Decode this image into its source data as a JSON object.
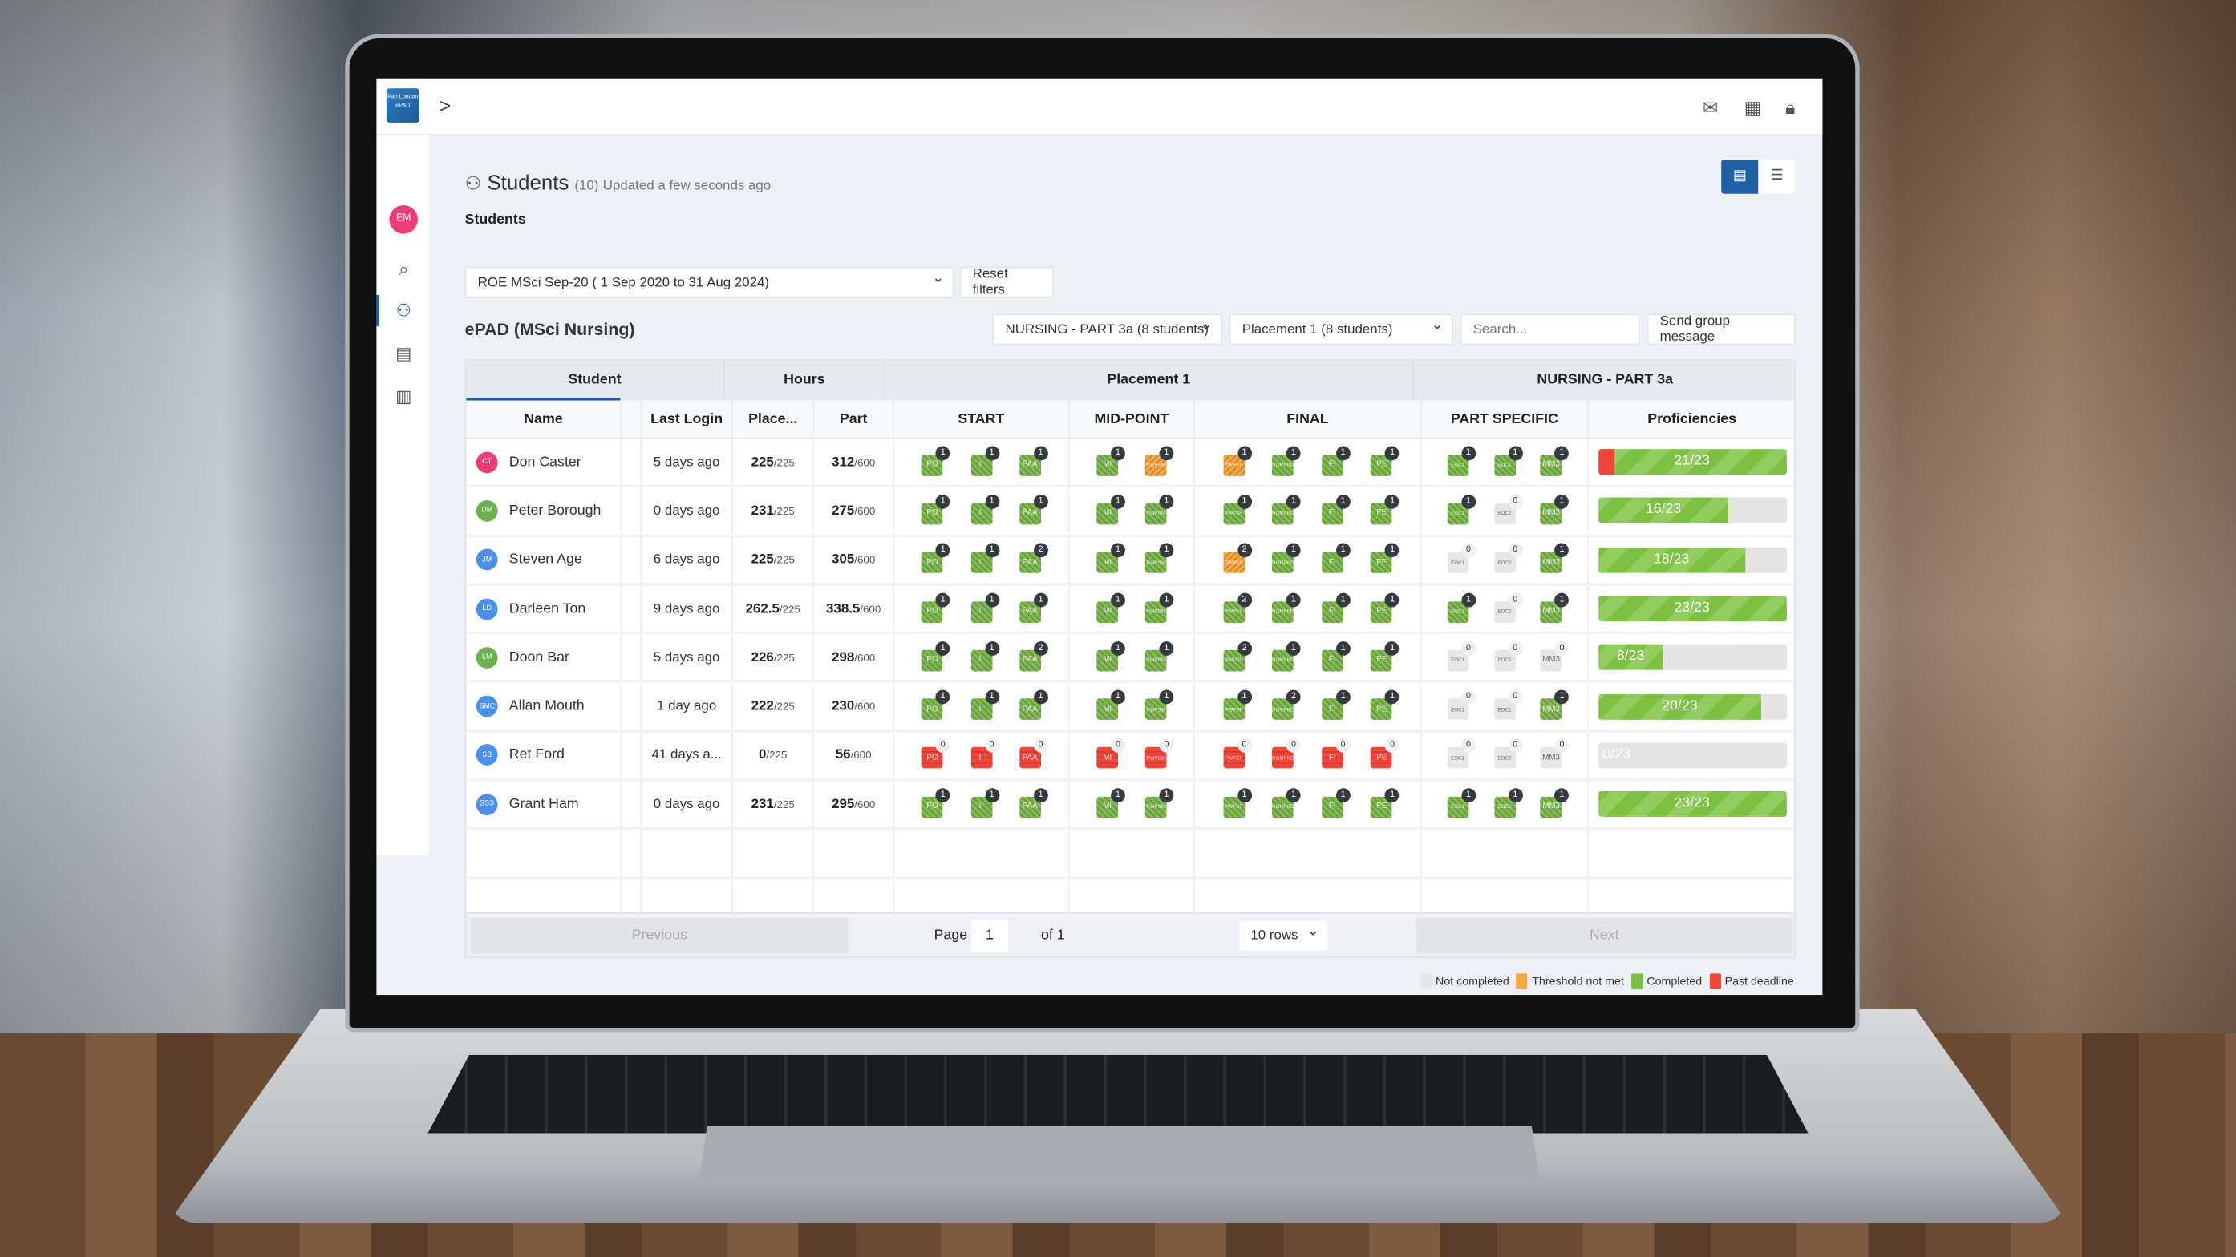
{
  "app": {
    "logo_text": "Pan London ePAD",
    "breadcrumb_icon": "chevron-right-icon",
    "user_initials": "EM",
    "top_icons": [
      "mail-icon",
      "grid-icon",
      "lock-icon"
    ],
    "side_icons": [
      "search-icon",
      "students-icon",
      "calendar-icon",
      "calculator-icon"
    ]
  },
  "page": {
    "title": "Students",
    "count": "(10)",
    "updated": "Updated a few seconds ago",
    "subtitle": "Students",
    "cohort_select": "ROE MSci Sep-20 ( 1 Sep 2020 to 31 Aug 2024)",
    "reset_label": "Reset filters",
    "section_title": "ePAD (MSci Nursing)",
    "part_select": "NURSING - PART 3a (8 students)",
    "placement_select": "Placement 1 (8 students)",
    "search_placeholder": "Search...",
    "send_label": "Send group message",
    "view_toggle": [
      "table-view-icon",
      "list-view-icon"
    ],
    "accent": "#1f5fa6"
  },
  "table": {
    "group_headers": [
      "Student",
      "Hours",
      "Placement 1",
      "NURSING - PART 3a"
    ],
    "headers": [
      "Name",
      "Last Login",
      "Place...",
      "Part",
      "START",
      "MID-POINT",
      "FINAL",
      "PART SPECIFIC",
      "Proficiencies"
    ],
    "tile_labels": {
      "start": [
        "PO",
        "II",
        "PAA"
      ],
      "mid": [
        "MI",
        "PWPSM"
      ],
      "final": [
        "PWPSF",
        "ROMPKD",
        "FI",
        "PE"
      ],
      "part": [
        "EOC1",
        "EOC2",
        "MM3"
      ]
    },
    "rows": [
      {
        "initials": "CT",
        "color": "#ee3c74",
        "name": "Don Caster",
        "login": "5 days ago",
        "place": "225",
        "place_total": "/225",
        "part": "312",
        "part_total": "/600",
        "start": [
          [
            "g",
            1
          ],
          [
            "g",
            1
          ],
          [
            "g",
            1
          ]
        ],
        "mid": [
          [
            "g",
            1
          ],
          [
            "o",
            1
          ]
        ],
        "final": [
          [
            "o",
            1
          ],
          [
            "g",
            1
          ],
          [
            "g",
            1
          ],
          [
            "g",
            1
          ]
        ],
        "ps": [
          [
            "g",
            1
          ],
          [
            "g",
            1
          ],
          [
            "g",
            1
          ]
        ],
        "prof": "21/23",
        "prof_fraction": 1,
        "prof_past_deadline_fraction": 0.087
      },
      {
        "initials": "DM",
        "color": "#6ab04c",
        "name": "Peter Borough",
        "login": "0 days ago",
        "place": "231",
        "place_total": "/225",
        "part": "275",
        "part_total": "/600",
        "start": [
          [
            "g",
            1
          ],
          [
            "g",
            1
          ],
          [
            "g",
            1
          ]
        ],
        "mid": [
          [
            "g",
            1
          ],
          [
            "g",
            1
          ]
        ],
        "final": [
          [
            "g",
            1
          ],
          [
            "g",
            1
          ],
          [
            "g",
            1
          ],
          [
            "g",
            1
          ]
        ],
        "ps": [
          [
            "g",
            1
          ],
          [
            "n",
            0
          ],
          [
            "g",
            1
          ]
        ],
        "prof": "16/23",
        "prof_fraction": 0.696
      },
      {
        "initials": "JM",
        "color": "#4a8fe8",
        "name": "Steven Age",
        "login": "6 days ago",
        "place": "225",
        "place_total": "/225",
        "part": "305",
        "part_total": "/600",
        "start": [
          [
            "g",
            1
          ],
          [
            "g",
            1
          ],
          [
            "g",
            2
          ]
        ],
        "mid": [
          [
            "g",
            1
          ],
          [
            "g",
            1
          ]
        ],
        "final": [
          [
            "o",
            2
          ],
          [
            "g",
            1
          ],
          [
            "g",
            1
          ],
          [
            "g",
            1
          ]
        ],
        "ps": [
          [
            "n",
            0
          ],
          [
            "n",
            0
          ],
          [
            "g",
            1
          ]
        ],
        "prof": "18/23",
        "prof_fraction": 0.783
      },
      {
        "initials": "LD",
        "color": "#4a8fe8",
        "name": "Darleen Ton",
        "login": "9 days ago",
        "place": "262.5",
        "place_total": "/225",
        "part": "338.5",
        "part_total": "/600",
        "start": [
          [
            "g",
            1
          ],
          [
            "g",
            1
          ],
          [
            "g",
            1
          ]
        ],
        "mid": [
          [
            "g",
            1
          ],
          [
            "g",
            1
          ]
        ],
        "final": [
          [
            "g",
            2
          ],
          [
            "g",
            1
          ],
          [
            "g",
            1
          ],
          [
            "g",
            1
          ]
        ],
        "ps": [
          [
            "g",
            1
          ],
          [
            "n",
            0
          ],
          [
            "g",
            1
          ]
        ],
        "prof": "23/23",
        "prof_fraction": 1
      },
      {
        "initials": "LM",
        "color": "#6ab04c",
        "name": "Doon Bar",
        "login": "5 days ago",
        "place": "226",
        "place_total": "/225",
        "part": "298",
        "part_total": "/600",
        "start": [
          [
            "g",
            1
          ],
          [
            "g",
            1
          ],
          [
            "g",
            2
          ]
        ],
        "mid": [
          [
            "g",
            1
          ],
          [
            "g",
            1
          ]
        ],
        "final": [
          [
            "g",
            2
          ],
          [
            "g",
            1
          ],
          [
            "g",
            1
          ],
          [
            "g",
            1
          ]
        ],
        "ps": [
          [
            "n",
            0
          ],
          [
            "n",
            0
          ],
          [
            "n",
            0
          ]
        ],
        "prof": "8/23",
        "prof_fraction": 0.348
      },
      {
        "initials": "SMC",
        "color": "#4a8fe8",
        "name": "Allan Mouth",
        "login": "1 day ago",
        "place": "222",
        "place_total": "/225",
        "part": "230",
        "part_total": "/600",
        "start": [
          [
            "g",
            1
          ],
          [
            "g",
            1
          ],
          [
            "g",
            1
          ]
        ],
        "mid": [
          [
            "g",
            1
          ],
          [
            "g",
            1
          ]
        ],
        "final": [
          [
            "g",
            1
          ],
          [
            "g",
            2
          ],
          [
            "g",
            1
          ],
          [
            "g",
            1
          ]
        ],
        "ps": [
          [
            "n",
            0
          ],
          [
            "n",
            0
          ],
          [
            "g",
            1
          ]
        ],
        "prof": "20/23",
        "prof_fraction": 0.87
      },
      {
        "initials": "SB",
        "color": "#4a8fe8",
        "name": "Ret Ford",
        "login": "41 days a...",
        "place": "0",
        "place_total": "/225",
        "part": "56",
        "part_total": "/600",
        "start": [
          [
            "r",
            0
          ],
          [
            "r",
            0
          ],
          [
            "r",
            0
          ]
        ],
        "mid": [
          [
            "r",
            0
          ],
          [
            "r",
            0
          ]
        ],
        "final": [
          [
            "r",
            0
          ],
          [
            "r",
            0
          ],
          [
            "r",
            0
          ],
          [
            "r",
            0
          ]
        ],
        "ps": [
          [
            "n",
            0
          ],
          [
            "n",
            0
          ],
          [
            "n",
            0
          ]
        ],
        "prof": "0/23",
        "prof_fraction": 0
      },
      {
        "initials": "SSS",
        "color": "#4a8fe8",
        "name": "Grant Ham",
        "login": "0 days ago",
        "place": "231",
        "place_total": "/225",
        "part": "295",
        "part_total": "/600",
        "start": [
          [
            "g",
            1
          ],
          [
            "g",
            1
          ],
          [
            "g",
            1
          ]
        ],
        "mid": [
          [
            "g",
            1
          ],
          [
            "g",
            1
          ]
        ],
        "final": [
          [
            "g",
            1
          ],
          [
            "g",
            1
          ],
          [
            "g",
            1
          ],
          [
            "g",
            1
          ]
        ],
        "ps": [
          [
            "g",
            1
          ],
          [
            "g",
            1
          ],
          [
            "g",
            1
          ]
        ],
        "prof": "23/23",
        "prof_fraction": 1
      }
    ]
  },
  "pagination": {
    "previous": "Previous",
    "page_label": "Page",
    "page_value": "1",
    "of_label": "of 1",
    "rows_select": "10 rows",
    "next": "Next"
  },
  "legend": [
    {
      "label": "Not completed",
      "color": "#e6e7e9"
    },
    {
      "label": "Threshold not met",
      "color": "#f4a83d"
    },
    {
      "label": "Completed",
      "color": "#7cc043"
    },
    {
      "label": "Past deadline",
      "color": "#f0453a"
    }
  ]
}
